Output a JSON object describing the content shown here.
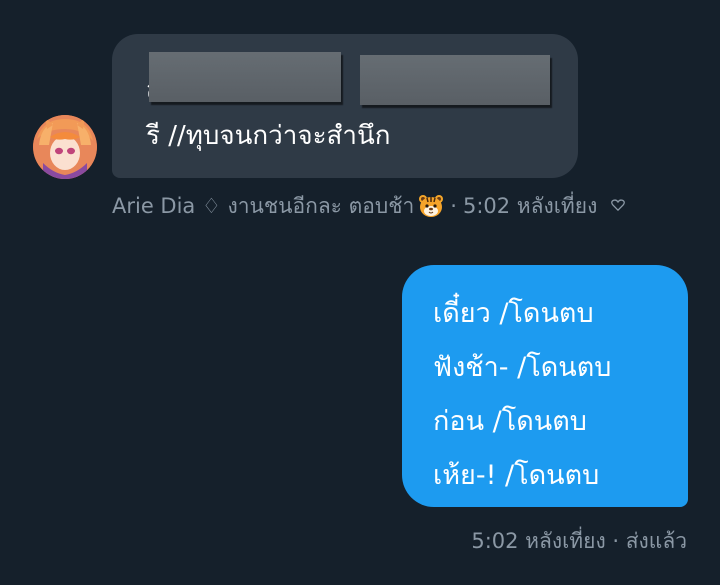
{
  "incoming": {
    "line1_start": "ส",
    "line1_mid": "ยเ",
    "line2": "รี //ทุบจนกว่าจะสำนึก",
    "sender_name": "Arie Dia ♢ งานชนอีกละ ตอบช้า",
    "sender_emoji_icon": "tiger-face-icon",
    "separator": "·",
    "time": "5:02 หลังเที่ยง",
    "reaction_icon": "heart-outline-icon"
  },
  "outgoing": {
    "lines": [
      "เดี๋ยว /โดนตบ",
      "ฟังช้า- /โดนตบ",
      "ก่อน /โดนตบ",
      "เห้ย-! /โดนตบ"
    ],
    "meta": "5:02 หลังเที่ยง · ส่งแล้ว"
  },
  "colors": {
    "background": "#15202b",
    "incoming_bubble": "#2f3a46",
    "outgoing_bubble": "#1d9bf0",
    "meta_text": "#8b98a5"
  }
}
